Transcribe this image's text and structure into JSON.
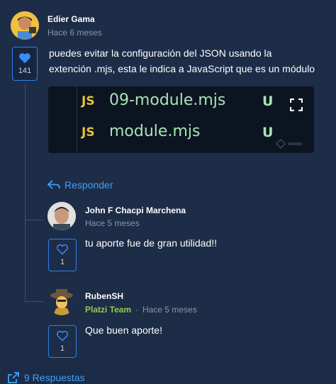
{
  "main_comment": {
    "author": "Edier Gama",
    "time": "Hace 6 meses",
    "likes": "141",
    "text_line1": "puedes evitar la configuración del JSON usando la",
    "text_line2": "extención .mjs, esta le indica a JavaScript que es un módulo",
    "image": {
      "rows": [
        {
          "tag": "JS",
          "file": "09-module.mjs",
          "state": "U"
        },
        {
          "tag": "JS",
          "file": "module.mjs",
          "state": "U"
        }
      ]
    },
    "reply_label": "Responder"
  },
  "replies": [
    {
      "author": "John F Chacpi Marchena",
      "time": "Hace 5 meses",
      "text": "tu aporte fue de gran utilidad!!",
      "likes": "1"
    },
    {
      "author": "RubenSH",
      "badge": "Platzi Team",
      "separator": "·",
      "time": "Hace 5 meses",
      "text": "Que buen aporte!",
      "likes": "1"
    }
  ],
  "footer": {
    "label": "9 Respuestas"
  },
  "colors": {
    "background": "#1d2c47",
    "accent": "#3ba3ff",
    "like_border": "#2f7ff0",
    "team": "#8ccc55"
  }
}
